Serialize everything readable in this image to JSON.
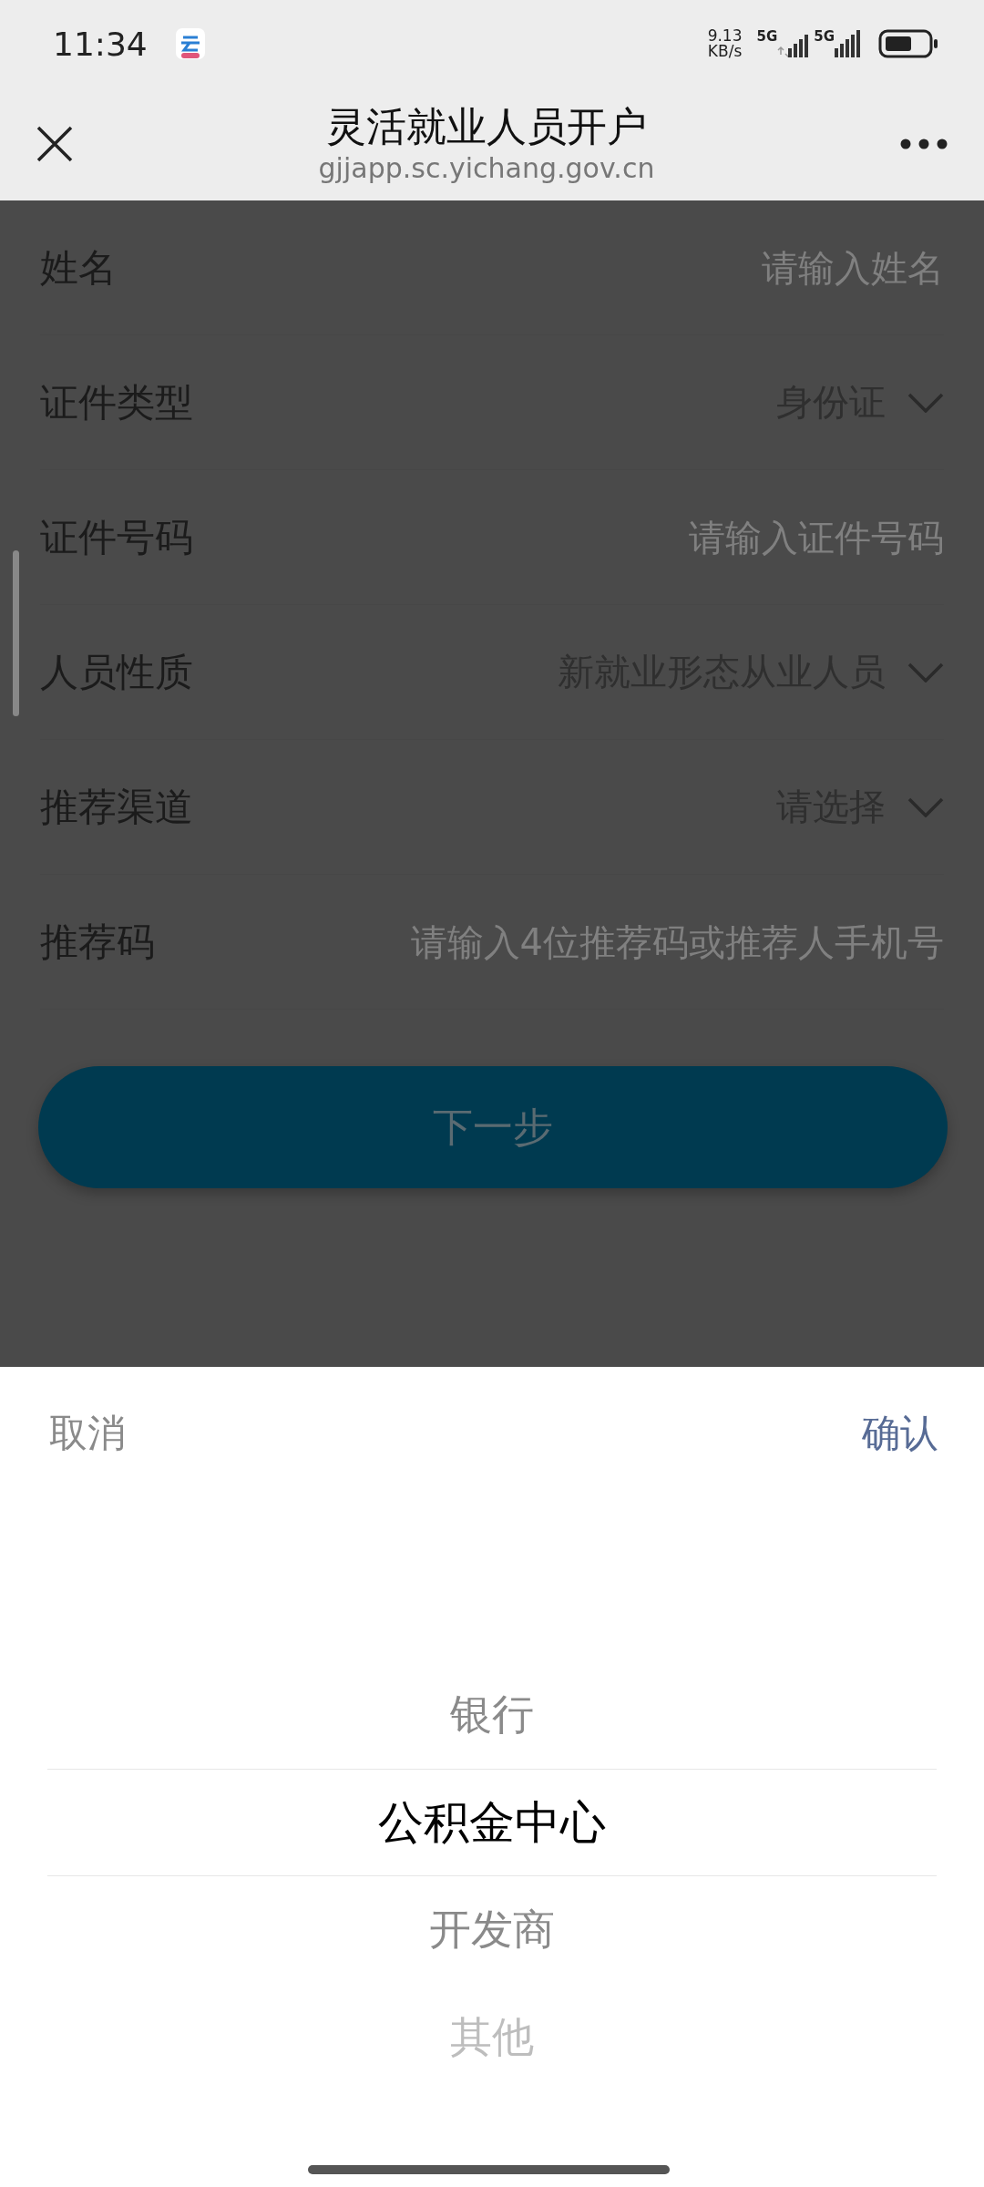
{
  "status_bar": {
    "time": "11:34",
    "net_speed": "9.13",
    "net_unit": "KB/s",
    "networks": [
      "5G",
      "5G"
    ]
  },
  "header": {
    "title": "灵活就业人员开户",
    "url": "gjjapp.sc.yichang.gov.cn"
  },
  "form": {
    "fields": [
      {
        "kind": "input",
        "label": "姓名",
        "placeholder": "请输入姓名"
      },
      {
        "kind": "select",
        "label": "证件类型",
        "value": "身份证"
      },
      {
        "kind": "input",
        "label": "证件号码",
        "placeholder": "请输入证件号码"
      },
      {
        "kind": "select",
        "label": "人员性质",
        "value": "新就业形态从业人员"
      },
      {
        "kind": "select",
        "label": "推荐渠道",
        "value": "请选择"
      },
      {
        "kind": "input",
        "label": "推荐码",
        "placeholder": "请输入4位推荐码或推荐人手机号"
      }
    ]
  },
  "next_button": {
    "label": "下一步"
  },
  "picker": {
    "cancel": "取消",
    "confirm": "确认",
    "options": [
      {
        "label": "银行",
        "selected": false
      },
      {
        "label": "公积金中心",
        "selected": true
      },
      {
        "label": "开发商",
        "selected": false
      },
      {
        "label": "其他",
        "selected": false
      }
    ]
  }
}
